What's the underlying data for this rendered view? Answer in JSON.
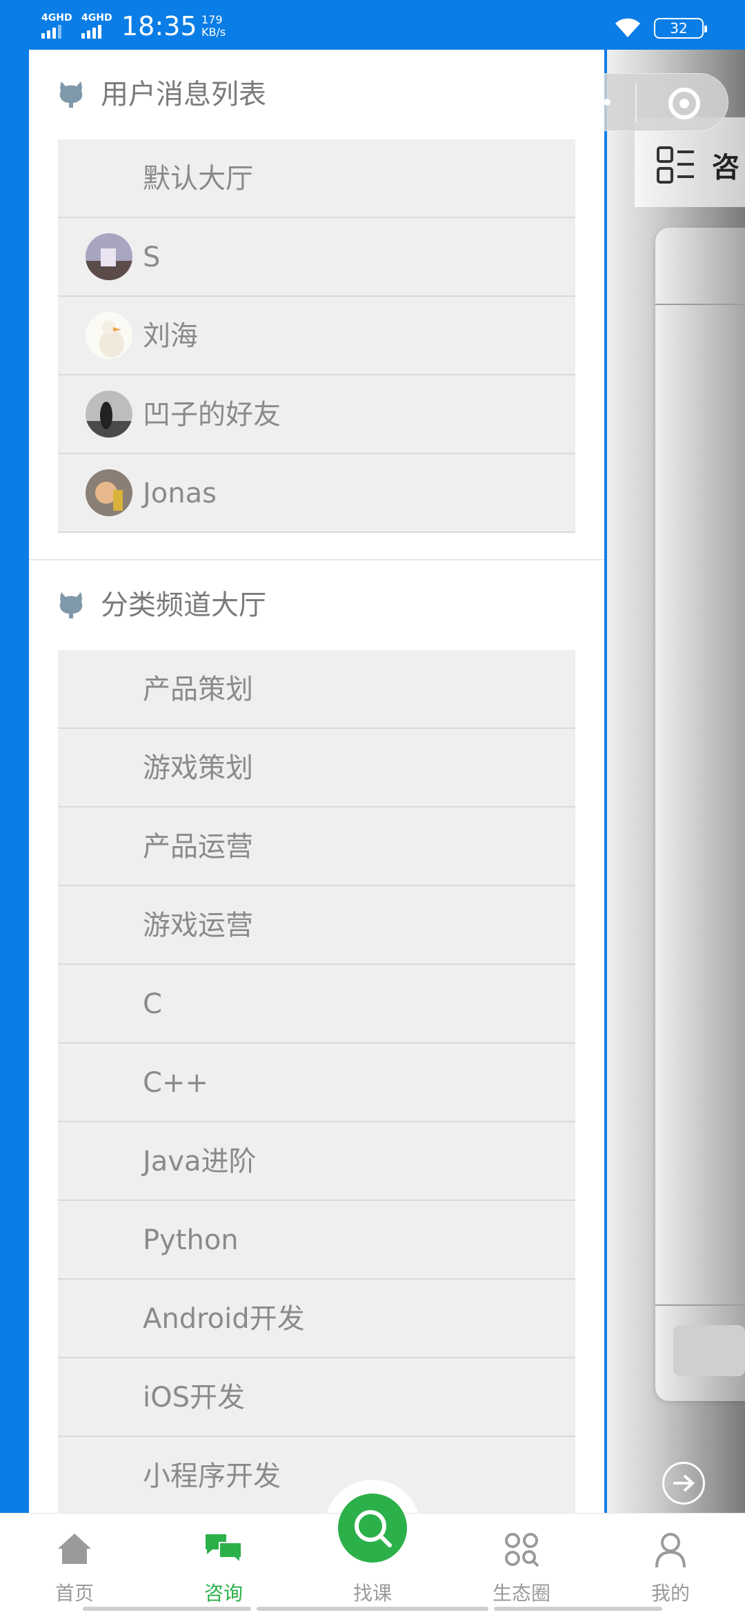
{
  "status_bar": {
    "network1": "4GHD",
    "network2": "4GHD",
    "time": "18:35",
    "speed_value": "179",
    "speed_unit": "KB/s",
    "battery": "32"
  },
  "background_page": {
    "title_peek": "咨"
  },
  "drawer": {
    "user_section": {
      "title": "用户消息列表",
      "icon": "github-cat-icon",
      "items": [
        {
          "label": "默认大厅",
          "avatar": false
        },
        {
          "label": "S",
          "avatar": true,
          "avatar_color": "#8c8ca8"
        },
        {
          "label": "刘海",
          "avatar": true,
          "avatar_color": "#f3efe3"
        },
        {
          "label": "凹子的好友",
          "avatar": true,
          "avatar_color": "#6d6d6d"
        },
        {
          "label": "Jonas",
          "avatar": true,
          "avatar_color": "#b7834e"
        }
      ]
    },
    "channel_section": {
      "title": "分类频道大厅",
      "icon": "github-cat-icon",
      "items": [
        {
          "label": "产品策划"
        },
        {
          "label": "游戏策划"
        },
        {
          "label": "产品运营"
        },
        {
          "label": "游戏运营"
        },
        {
          "label": "C"
        },
        {
          "label": "C++"
        },
        {
          "label": "Java进阶"
        },
        {
          "label": "Python"
        },
        {
          "label": "Android开发"
        },
        {
          "label": "iOS开发"
        },
        {
          "label": "小程序开发"
        }
      ]
    }
  },
  "tabbar": {
    "tabs": [
      {
        "label": "首页",
        "icon": "home-icon",
        "active": false
      },
      {
        "label": "咨询",
        "icon": "chat-icon",
        "active": true
      },
      {
        "label": "找课",
        "icon": "search-icon",
        "active": false
      },
      {
        "label": "生态圈",
        "icon": "apps-icon",
        "active": false
      },
      {
        "label": "我的",
        "icon": "user-icon",
        "active": false
      }
    ]
  },
  "colors": {
    "accent_blue": "#0a7de6",
    "active_green": "#2bb04a",
    "list_bg": "#efefef"
  }
}
